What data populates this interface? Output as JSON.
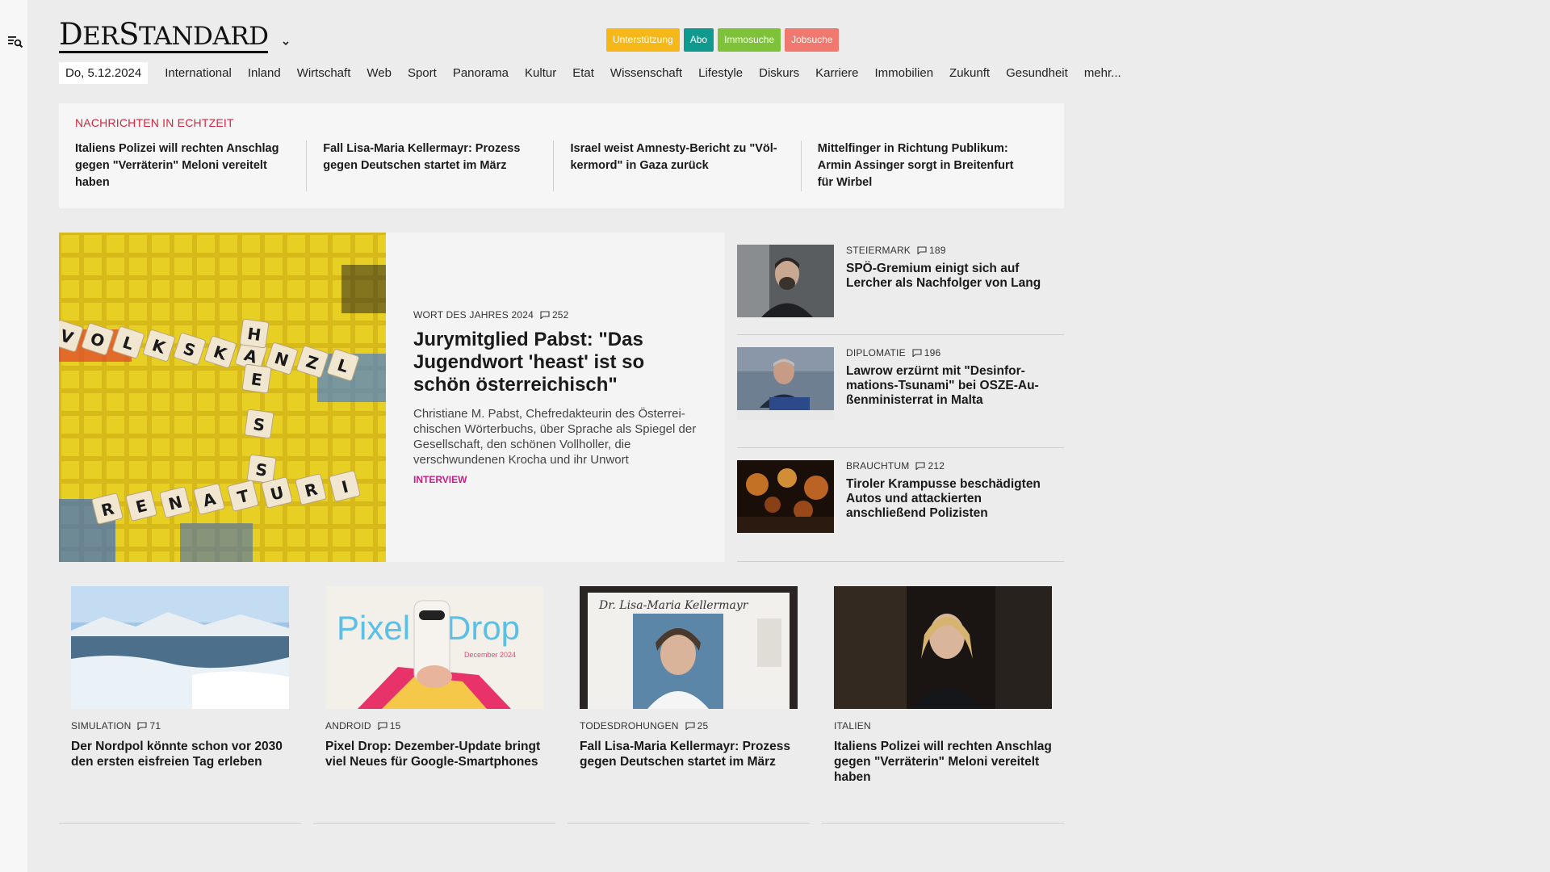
{
  "logo": {
    "text_big1": "D",
    "text_rest1": "ER",
    "text_big2": "S",
    "text_rest2": "TANDARD"
  },
  "service_buttons": [
    {
      "label": "Unterstützung",
      "color": "#f6b718"
    },
    {
      "label": "Abo",
      "color": "#109a8f"
    },
    {
      "label": "Immosuche",
      "color": "#7ec23a"
    },
    {
      "label": "Jobsuche",
      "color": "#f0786e"
    }
  ],
  "nav": {
    "date": "Do, 5.12.2024",
    "items": [
      "International",
      "Inland",
      "Wirtschaft",
      "Web",
      "Sport",
      "Panorama",
      "Kultur",
      "Etat",
      "Wissenschaft",
      "Lifestyle",
      "Diskurs",
      "Karriere",
      "Immobilien",
      "Zukunft",
      "Gesundheit",
      "mehr..."
    ]
  },
  "ticker": {
    "heading": "NACHRICHTEN IN ECHTZEIT",
    "items": [
      "Italiens Polizei will rechten Anschlag gegen \"Verräterin\" Meloni vereitelt haben",
      "Fall Lisa-Maria Kellermayr: Prozess gegen Deutschen startet im März",
      "Israel weist Amnesty-Bericht zu \"Völ-kermord\" in Gaza zurück",
      "Mittelfinger in Richtung Publikum: Armin Assinger sorgt in Breitenfurt für Wirbel"
    ]
  },
  "lead": {
    "kicker": "Wort des Jahres 2024",
    "comments": "252",
    "title": "Jurymitglied Pabst: \"Das Jugendwort 'heast' ist so schön österreichisch\"",
    "teaser": "Christiane M. Pabst, Chefredakteurin des Österrei-chischen Wörterbuchs, über Sprache als Spiegel der Gesellschaft, den schönen Vollholler, die verschwundenen Krocha und ihr Unwort",
    "tag": "INTERVIEW",
    "tiles_word1": [
      "V",
      "O",
      "L",
      "K",
      "S",
      "K",
      "A",
      "N",
      "Z",
      "L"
    ],
    "tiles_word2": [
      "H",
      "E",
      "S",
      "S"
    ],
    "tiles_word3": [
      "R",
      "E",
      "N",
      "A",
      "T",
      "U",
      "R",
      "I"
    ]
  },
  "side": [
    {
      "kicker": "Steiermark",
      "comments": "189",
      "title": "SPÖ-Gremium einigt sich auf Lercher als Nachfolger von Lang"
    },
    {
      "kicker": "Diplomatie",
      "comments": "196",
      "title": "Lawrow erzürnt mit \"Desinfor-mations-Tsunami\" bei OSZE-Au-ßenministerrat in Malta"
    },
    {
      "kicker": "Brauchtum",
      "comments": "212",
      "title": "Tiroler Krampusse beschädigten Autos und attackierten anschließend Polizisten"
    }
  ],
  "cards": [
    {
      "kicker": "Simulation",
      "comments": "71",
      "title": "Der Nordpol könnte schon vor 2030 den ersten eisfreien Tag erleben"
    },
    {
      "kicker": "Android",
      "comments": "15",
      "title": "Pixel Drop: Dezember-Update bringt viel Neues für Google-Smartphones",
      "img_word1": "Pixel",
      "img_word2": "Drop",
      "img_sub": "December 2024"
    },
    {
      "kicker": "Todesdrohungen",
      "comments": "25",
      "title": "Fall Lisa-Maria Kellermayr: Prozess gegen Deutschen startet im März",
      "img_caption": "Dr. Lisa-Maria Kellermayr"
    },
    {
      "kicker": "Italien",
      "comments": "",
      "title": "Italiens Polizei will rechten Anschlag gegen \"Verräterin\" Meloni vereitelt haben"
    }
  ]
}
